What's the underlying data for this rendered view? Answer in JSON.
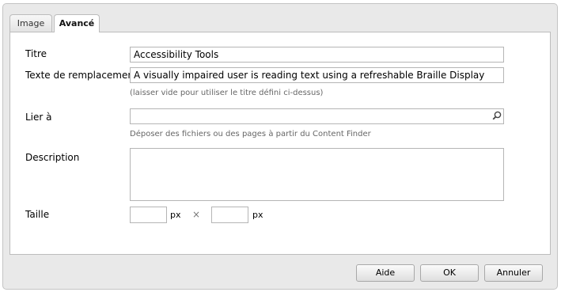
{
  "tabs": [
    {
      "label": "Image"
    },
    {
      "label": "Avancé"
    }
  ],
  "form": {
    "title_label": "Titre",
    "title_value": "Accessibility Tools",
    "alt_label": "Texte de remplacement",
    "alt_value": "A visually impaired user is reading text using a refreshable Braille Display",
    "alt_hint": "(laisser vide pour utiliser le titre défini ci-dessus)",
    "link_label": "Lier à",
    "link_value": "",
    "link_hint": "Déposer des fichiers ou des pages à partir du Content Finder",
    "link_button_icon": "search-icon",
    "description_label": "Description",
    "description_value": "",
    "size_label": "Taille",
    "width_value": "",
    "height_value": "",
    "unit": "px",
    "times": "×"
  },
  "buttons": {
    "help": "Aide",
    "ok": "OK",
    "cancel": "Annuler"
  }
}
